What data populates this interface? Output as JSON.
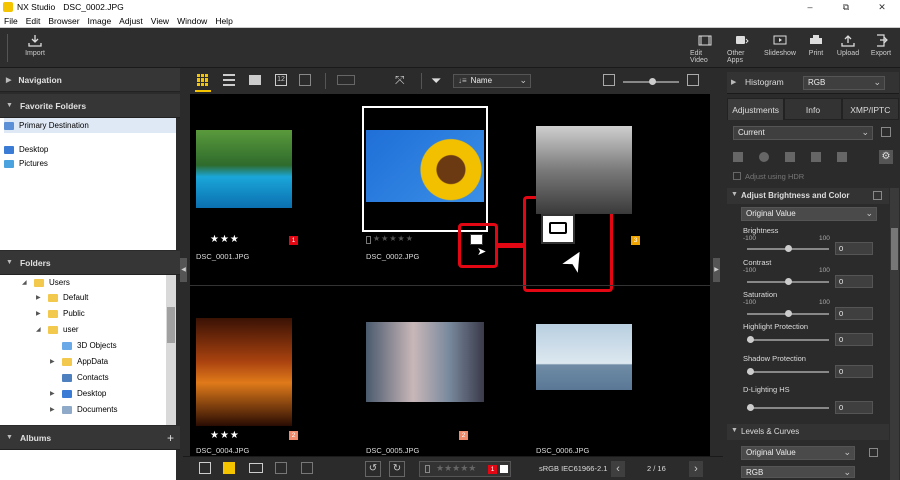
{
  "window": {
    "app_name": "NX Studio",
    "file": "DSC_0002.JPG",
    "minimize": "–",
    "maximize": "⧉",
    "close": "✕"
  },
  "menu": [
    "File",
    "Edit",
    "Browser",
    "Image",
    "Adjust",
    "View",
    "Window",
    "Help"
  ],
  "toolbar": {
    "import": "Import",
    "edit_video": "Edit Video",
    "other_apps": "Other Apps",
    "slideshow": "Slideshow",
    "print": "Print",
    "upload": "Upload",
    "export": "Export"
  },
  "left": {
    "navigation": "Navigation",
    "favorite_folders": "Favorite Folders",
    "favorites": [
      "Primary Destination",
      "Desktop",
      "Pictures"
    ],
    "folders": "Folders",
    "tree": [
      "Users",
      "Default",
      "Public",
      "user",
      "3D Objects",
      "AppData",
      "Contacts",
      "Desktop",
      "Documents"
    ],
    "albums": "Albums",
    "albums_add": "+"
  },
  "center_toolbar": {
    "sort_label": "Name"
  },
  "thumbnails": [
    {
      "name": "DSC_0001.JPG",
      "stars": "★★★",
      "label": "1",
      "label_color": "#e30613"
    },
    {
      "name": "DSC_0002.JPG",
      "stars": "★★★★★",
      "label": ""
    },
    {
      "name": "",
      "stars": "",
      "label": "3",
      "label_color": "#f0a500"
    },
    {
      "name": "DSC_0004.JPG",
      "stars": "★★★",
      "label": "2",
      "label_color": "#f28b6b"
    },
    {
      "name": "DSC_0005.JPG",
      "stars": "",
      "label": "2",
      "label_color": "#f28b6b"
    },
    {
      "name": "DSC_0006.JPG",
      "stars": "",
      "label": ""
    }
  ],
  "bottom": {
    "stars": "★★★★★",
    "label": "1",
    "color_profile": "sRGB IEC61966-2.1",
    "page": "2 / 16",
    "prev": "‹",
    "next": "›"
  },
  "right": {
    "histogram": "Histogram",
    "histogram_mode": "RGB",
    "tabs": [
      "Adjustments",
      "Info",
      "XMP/IPTC"
    ],
    "preset": "Current",
    "adjust_hdr": "Adjust using HDR",
    "section1": "Adjust Brightness and Color",
    "section1_mode": "Original Value",
    "sliders": [
      {
        "label": "Brightness",
        "min": "-100",
        "max": "100",
        "value": "0"
      },
      {
        "label": "Contrast",
        "min": "-100",
        "max": "100",
        "value": "0"
      },
      {
        "label": "Saturation",
        "min": "-100",
        "max": "100",
        "value": "0"
      },
      {
        "label": "Highlight Protection",
        "min": "",
        "max": "",
        "value": "0"
      },
      {
        "label": "Shadow Protection",
        "min": "",
        "max": "",
        "value": "0"
      },
      {
        "label": "D-Lighting HS",
        "min": "",
        "max": "",
        "value": "0"
      }
    ],
    "section2": "Levels & Curves",
    "section2_mode": "Original Value",
    "section2_channel": "RGB"
  },
  "colors": {
    "accent_red": "#e30613",
    "folder_yellow": "#f2c94c",
    "view_active": "#f5c400"
  }
}
